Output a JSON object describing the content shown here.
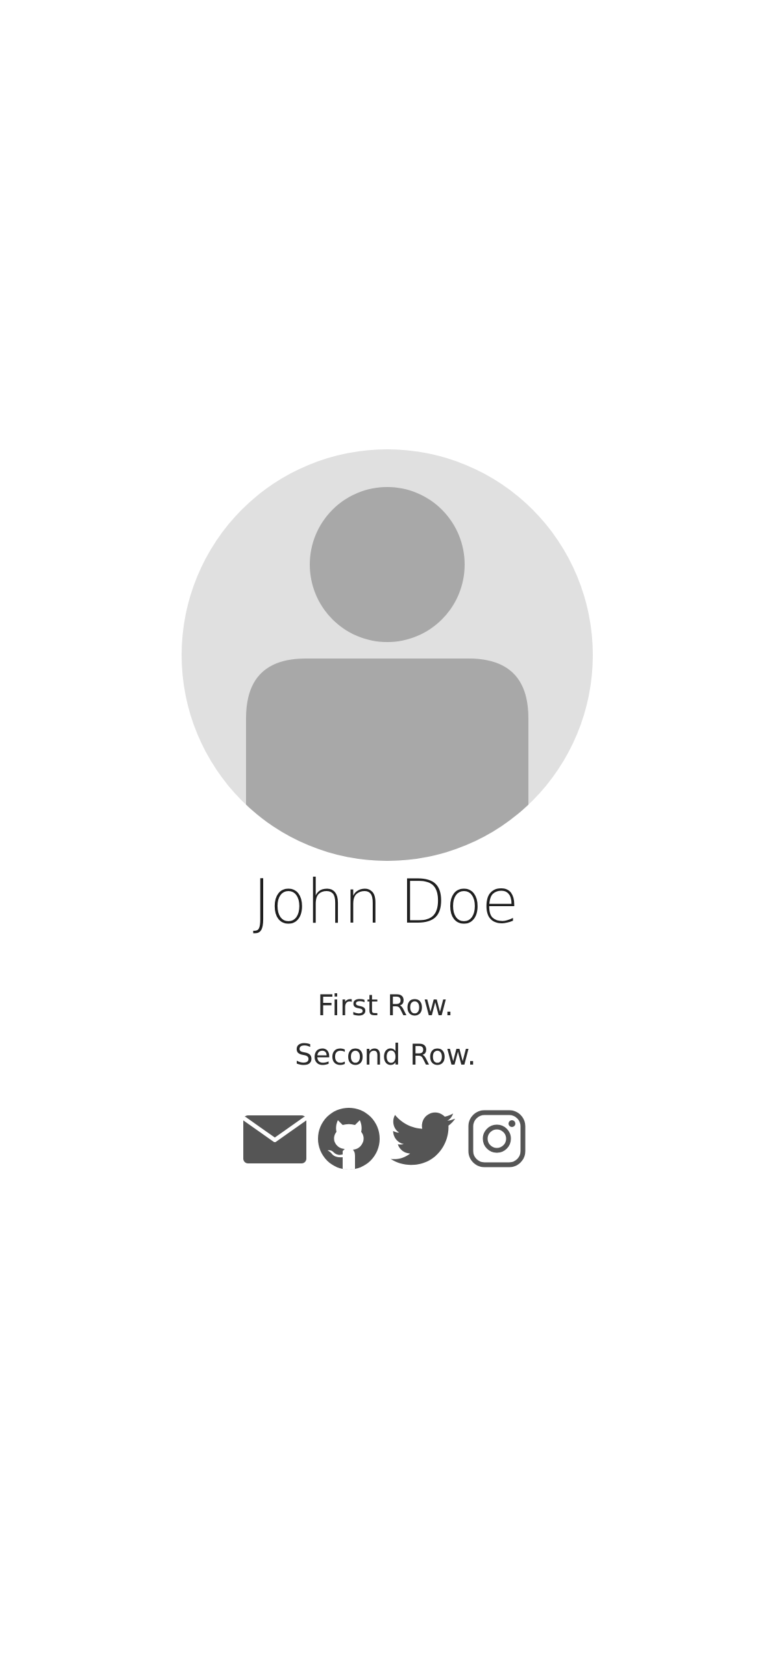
{
  "profile": {
    "name": "John Doe",
    "bio_lines": [
      "First Row.",
      "Second Row."
    ],
    "avatar_icon": "default-user-avatar-icon"
  },
  "social_links": [
    {
      "icon": "mail-icon"
    },
    {
      "icon": "github-icon"
    },
    {
      "icon": "twitter-icon"
    },
    {
      "icon": "instagram-icon"
    }
  ],
  "colors": {
    "avatar_background": "#e0e0e0",
    "avatar_figure": "#a8a8a8",
    "icon_color": "#555555",
    "text": "#1f1f1f"
  }
}
